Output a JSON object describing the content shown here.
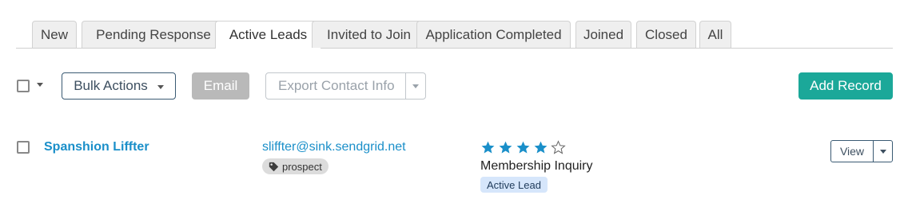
{
  "tabs": [
    {
      "label": "New"
    },
    {
      "label": "Pending Response"
    },
    {
      "label": "Active Leads"
    },
    {
      "label": "Invited to Join"
    },
    {
      "label": "Application Completed"
    },
    {
      "label": "Joined"
    },
    {
      "label": "Closed"
    },
    {
      "label": "All"
    }
  ],
  "active_tab": "Active Leads",
  "toolbar": {
    "bulk_actions_label": "Bulk Actions",
    "email_label": "Email",
    "export_label": "Export Contact Info",
    "add_record_label": "Add Record"
  },
  "records": [
    {
      "name": "Spanshion Liffter",
      "email": "sliffter@sink.sendgrid.net",
      "tag": "prospect",
      "rating": 4,
      "rating_max": 5,
      "source": "Membership Inquiry",
      "status": "Active Lead",
      "view_label": "View"
    }
  ],
  "colors": {
    "accent": "#1ba899",
    "link": "#1a8fc9",
    "star": "#1a8fc9",
    "status_bg": "#d6e6fb"
  }
}
